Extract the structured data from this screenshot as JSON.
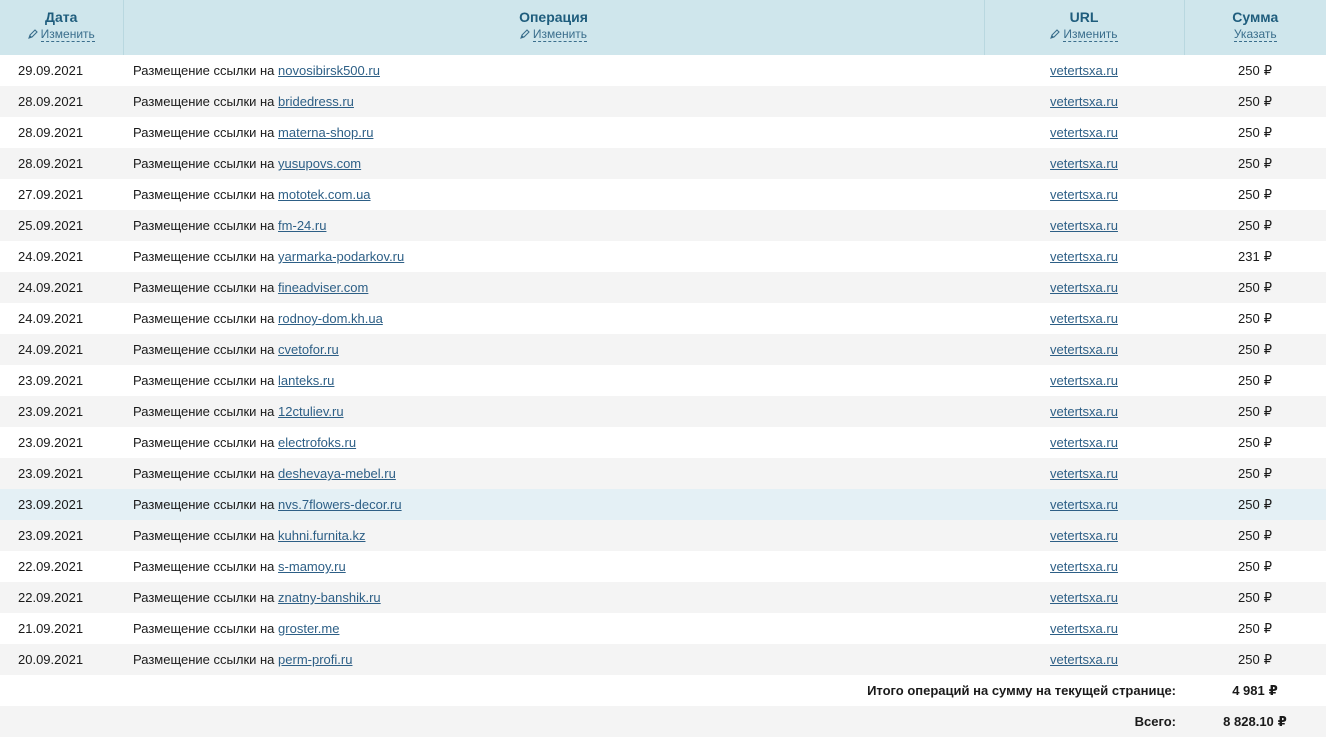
{
  "header": {
    "date": {
      "title": "Дата",
      "action": "Изменить"
    },
    "operation": {
      "title": "Операция",
      "action": "Изменить"
    },
    "url": {
      "title": "URL",
      "action": "Изменить"
    },
    "sum": {
      "title": "Сумма",
      "action": "Указать"
    }
  },
  "op_prefix": "Размещение ссылки на",
  "currency": "₽",
  "rows": [
    {
      "date": "29.09.2021",
      "site": "novosibirsk500.ru",
      "url": "vetertsxa.ru",
      "amount": "250"
    },
    {
      "date": "28.09.2021",
      "site": "bridedress.ru",
      "url": "vetertsxa.ru",
      "amount": "250"
    },
    {
      "date": "28.09.2021",
      "site": "materna-shop.ru",
      "url": "vetertsxa.ru",
      "amount": "250"
    },
    {
      "date": "28.09.2021",
      "site": "yusupovs.com",
      "url": "vetertsxa.ru",
      "amount": "250"
    },
    {
      "date": "27.09.2021",
      "site": "mototek.com.ua",
      "url": "vetertsxa.ru",
      "amount": "250"
    },
    {
      "date": "25.09.2021",
      "site": "fm-24.ru",
      "url": "vetertsxa.ru",
      "amount": "250"
    },
    {
      "date": "24.09.2021",
      "site": "yarmarka-podarkov.ru",
      "url": "vetertsxa.ru",
      "amount": "231"
    },
    {
      "date": "24.09.2021",
      "site": "fineadviser.com",
      "url": "vetertsxa.ru",
      "amount": "250"
    },
    {
      "date": "24.09.2021",
      "site": "rodnoy-dom.kh.ua",
      "url": "vetertsxa.ru",
      "amount": "250"
    },
    {
      "date": "24.09.2021",
      "site": "cvetofor.ru",
      "url": "vetertsxa.ru",
      "amount": "250"
    },
    {
      "date": "23.09.2021",
      "site": "lanteks.ru",
      "url": "vetertsxa.ru",
      "amount": "250"
    },
    {
      "date": "23.09.2021",
      "site": "12ctuliev.ru",
      "url": "vetertsxa.ru",
      "amount": "250"
    },
    {
      "date": "23.09.2021",
      "site": "electrofoks.ru",
      "url": "vetertsxa.ru",
      "amount": "250"
    },
    {
      "date": "23.09.2021",
      "site": "deshevaya-mebel.ru",
      "url": "vetertsxa.ru",
      "amount": "250"
    },
    {
      "date": "23.09.2021",
      "site": "nvs.7flowers-decor.ru",
      "url": "vetertsxa.ru",
      "amount": "250"
    },
    {
      "date": "23.09.2021",
      "site": "kuhni.furnita.kz",
      "url": "vetertsxa.ru",
      "amount": "250"
    },
    {
      "date": "22.09.2021",
      "site": "s-mamoy.ru",
      "url": "vetertsxa.ru",
      "amount": "250"
    },
    {
      "date": "22.09.2021",
      "site": "znatny-banshik.ru",
      "url": "vetertsxa.ru",
      "amount": "250"
    },
    {
      "date": "21.09.2021",
      "site": "groster.me",
      "url": "vetertsxa.ru",
      "amount": "250"
    },
    {
      "date": "20.09.2021",
      "site": "perm-profi.ru",
      "url": "vetertsxa.ru",
      "amount": "250"
    }
  ],
  "totals": {
    "page_label": "Итого операций на сумму на текущей странице:",
    "page_value": "4 981",
    "all_label": "Всего:",
    "all_value": "8 828.10"
  },
  "colors": {
    "header_bg": "#cfe6ec",
    "header_text": "#1f5d7d",
    "link": "#2d5f86",
    "row_alt": "#f4f4f4",
    "row_highlight": "#e4f0f5"
  },
  "highlighted_row": 14
}
